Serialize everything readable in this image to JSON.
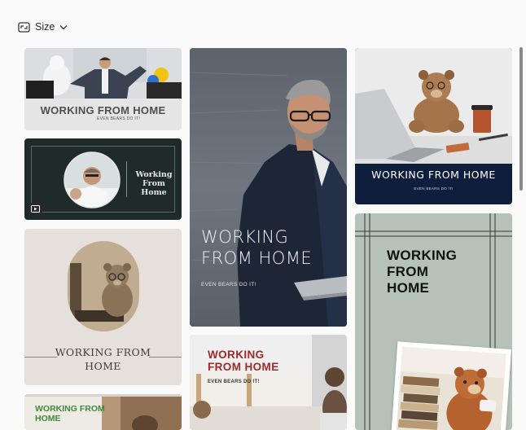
{
  "toolbar": {
    "size_label": "Size",
    "size_icon": "resize-icon",
    "chevron_icon": "chevron-down-icon"
  },
  "templates": {
    "t1": {
      "title": "WORKING FROM HOME",
      "subtitle": "EVEN BEARS DO IT!"
    },
    "t2": {
      "title_line1": "Working",
      "title_line2": "From Home",
      "badge_icon": "video-play-icon"
    },
    "t3": {
      "title_line1": "WORKING",
      "title_line2": "FROM HOME",
      "subtitle": "EVEN BEARS DO IT!"
    },
    "t4": {
      "title": "WORKING FROM HOME",
      "subtitle": "EVEN BEARS DO IT!"
    },
    "t5": {
      "title_line1": "WORKING FROM",
      "title_line2": "HOME"
    },
    "t6": {
      "title_line1": "WORKING",
      "title_line2": "FROM HOME",
      "subtitle": "EVEN BEARS DO IT!"
    },
    "t7": {
      "title_line1": "WORKING",
      "title_line2": "FROM",
      "title_line3": "HOME"
    },
    "t8": {
      "title_line1": "WORKING FROM",
      "title_line2": "HOME"
    }
  },
  "colors": {
    "navy": "#0f1e3c",
    "dark_green": "#1e2b28",
    "sage": "#b6c2b8",
    "beige": "#e5e0db",
    "red_title": "#9c2a28",
    "green_title": "#3f8a3a"
  }
}
